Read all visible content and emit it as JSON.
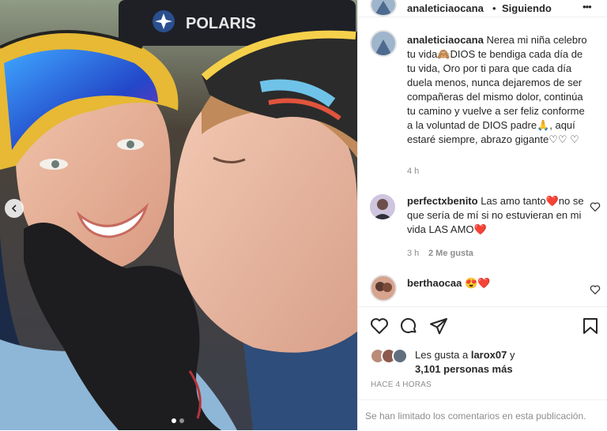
{
  "post": {
    "photo_brand_text": "POLARIS",
    "carousel_dots": 2,
    "carousel_active": 0
  },
  "header": {
    "username": "analeticiaocana",
    "separator": "•",
    "follow_status": "Siguiendo",
    "more_label": "•••"
  },
  "caption": {
    "username": "analeticiaocana",
    "text": "Nerea mi niña celebro tu vida🙈DIOS te bendiga cada día de tu vida, Oro por ti para que cada día duela menos, nunca dejaremos de ser compañeras del mismo dolor, continúa tu camino y vuelve a ser feliz conforme a la voluntad de DIOS padre🙏, aquí estaré siempre, abrazo gigante♡♡ ♡",
    "time": "4 h"
  },
  "comments": [
    {
      "username": "perfectxbenito",
      "text": "Las amo tanto❤️no se que sería de mí si no estuvieran en mi vida LAS AMO❤️",
      "time": "3 h",
      "likes": "2 Me gusta"
    },
    {
      "username": "berthaocaa",
      "text": "😍❤️"
    }
  ],
  "likes": {
    "prefix": "Les gusta a",
    "user": "larox07",
    "connector": "y",
    "count": "3,101 personas más"
  },
  "timestamp": "HACE 4 HORAS",
  "comments_limited": "Se han limitado los comentarios en esta publicación.",
  "colors": {
    "heart_red": "#ed4956",
    "meta_gray": "#8e8e8e",
    "text": "#262626"
  }
}
